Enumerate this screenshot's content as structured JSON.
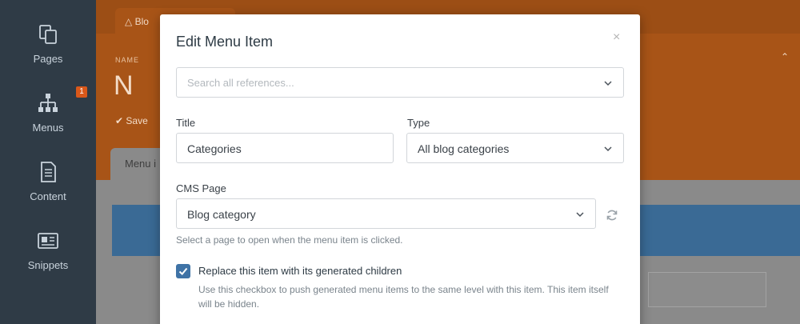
{
  "sidebar": {
    "items": [
      {
        "label": "Pages",
        "icon": "pages-icon"
      },
      {
        "label": "Menus",
        "icon": "menus-icon",
        "badge": "1"
      },
      {
        "label": "Content",
        "icon": "content-icon"
      },
      {
        "label": "Snippets",
        "icon": "snippets-icon"
      }
    ]
  },
  "background": {
    "tab_label": "Blo",
    "name_label": "NAME",
    "name_value": "N",
    "save_label": "Save",
    "menu_tab_label": "Menu i"
  },
  "modal": {
    "title": "Edit Menu Item",
    "close_glyph": "×",
    "search": {
      "placeholder": "Search all references..."
    },
    "title_label": "Title",
    "title_value": "Categories",
    "type_label": "Type",
    "type_value": "All blog categories",
    "cms_page_label": "CMS Page",
    "cms_page_value": "Blog category",
    "cms_page_help": "Select a page to open when the menu item is clicked.",
    "replace": {
      "checked": true,
      "label": "Replace this item with its generated children",
      "help": "Use this checkbox to push generated menu items to the same level with this item. This item itself will be hidden."
    }
  },
  "colors": {
    "sidebar": "#2f3b46",
    "accent_orange": "#a85417",
    "checkbox_blue": "#3f73a6",
    "selected_row_blue": "#3a6a95"
  }
}
